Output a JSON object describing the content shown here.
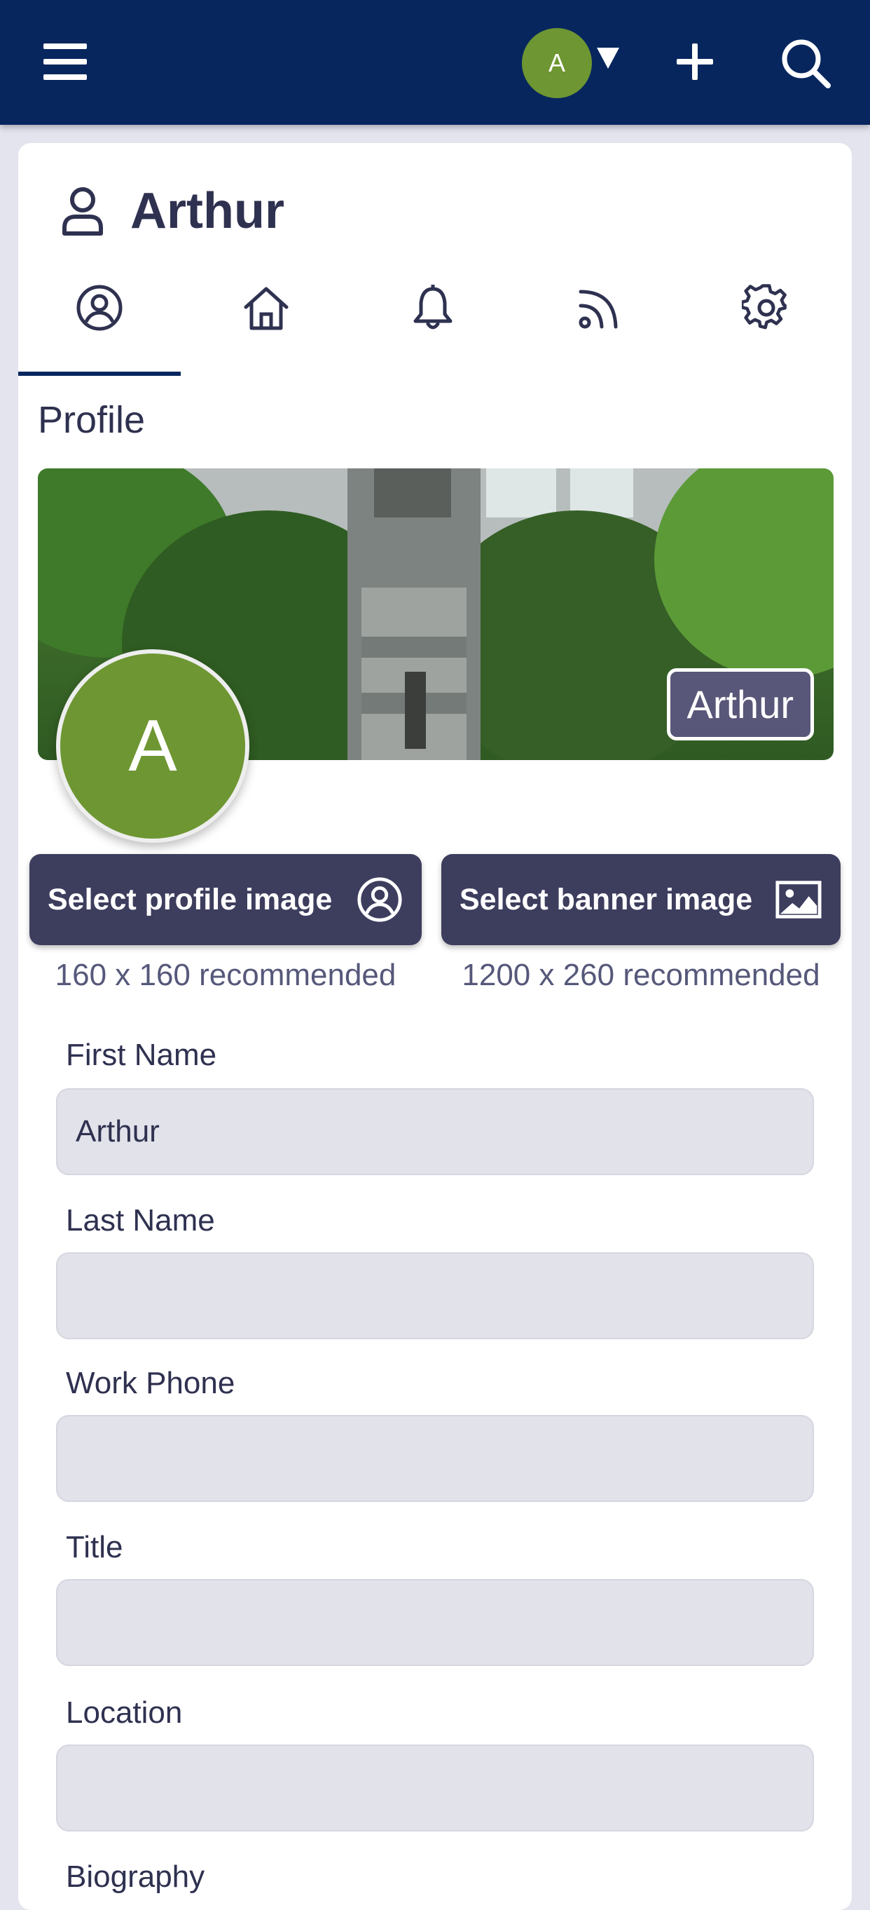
{
  "topbar": {
    "avatar_initial": "A"
  },
  "header": {
    "user_name": "Arthur"
  },
  "tabs": [
    {
      "icon": "profile-circle-icon",
      "active": true
    },
    {
      "icon": "home-icon",
      "active": false
    },
    {
      "icon": "bell-icon",
      "active": false
    },
    {
      "icon": "feed-icon",
      "active": false
    },
    {
      "icon": "gear-icon",
      "active": false
    }
  ],
  "section": {
    "title": "Profile"
  },
  "banner": {
    "name_label": "Arthur"
  },
  "profile_avatar": {
    "initial": "A"
  },
  "buttons": {
    "profile_image": "Select profile image",
    "profile_hint": "160 x 160 recommended",
    "banner_image": "Select banner image",
    "banner_hint": "1200 x 260 recommended"
  },
  "form": {
    "first_name": {
      "label": "First Name",
      "value": "Arthur"
    },
    "last_name": {
      "label": "Last Name",
      "value": ""
    },
    "work_phone": {
      "label": "Work Phone",
      "value": ""
    },
    "title": {
      "label": "Title",
      "value": ""
    },
    "location": {
      "label": "Location",
      "value": ""
    },
    "biography": {
      "label": "Biography"
    }
  },
  "colors": {
    "topbar": "#07265e",
    "avatar": "#6e9632",
    "button": "#3d3d5e",
    "input_bg": "#e2e2ea",
    "page_bg": "#e4e4ee"
  }
}
